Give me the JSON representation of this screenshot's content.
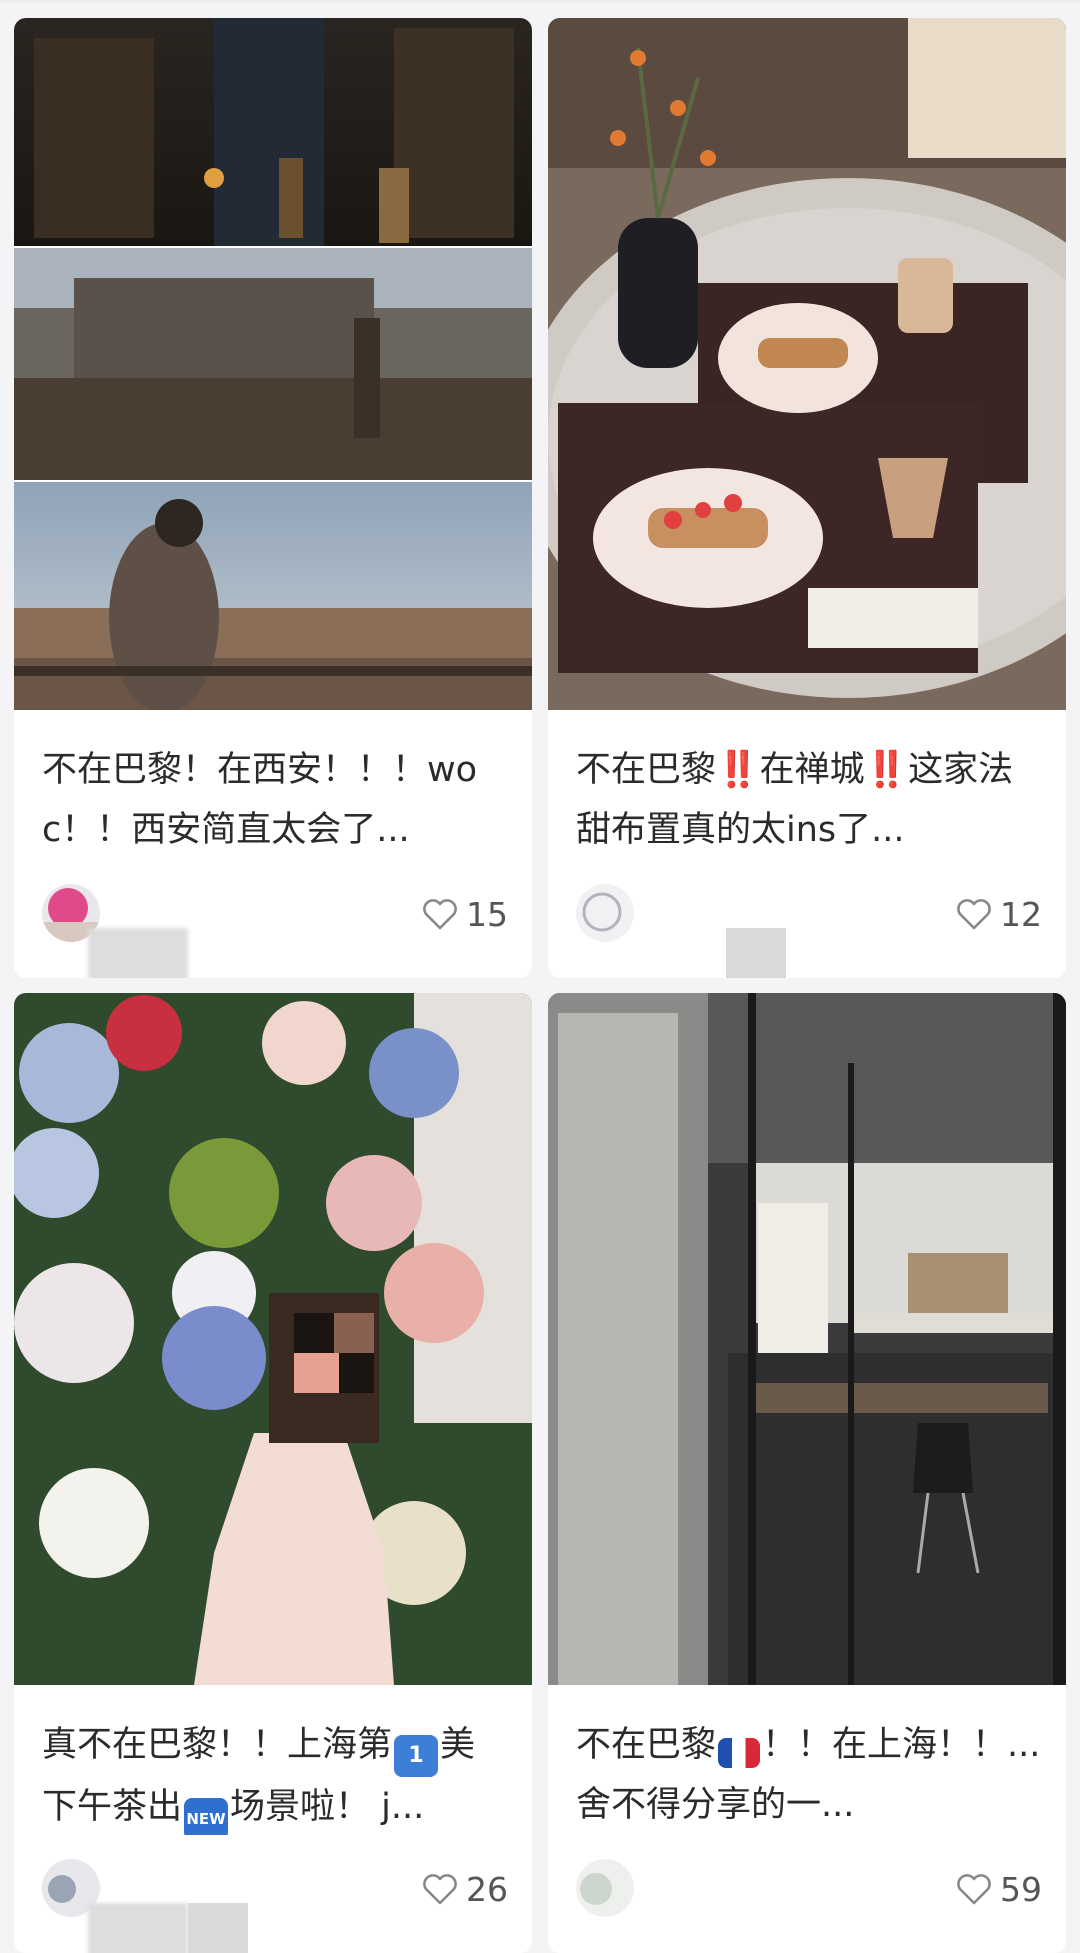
{
  "posts": [
    {
      "title": "不在巴黎！在西安！！！woc！！西安简直太会了...",
      "likes": "15",
      "image": "medieval-city-game-scenes"
    },
    {
      "title": "不在巴黎‼️在禅城‼️这家法甜布置真的太ins了...",
      "likes": "12",
      "image": "cafe-dessert-trays"
    },
    {
      "title_parts": [
        "真不在巴黎！！上海第",
        "1",
        "美下午茶出",
        "NEW",
        "场景啦！ j..."
      ],
      "likes": "26",
      "image": "flower-wall-portrait"
    },
    {
      "title_parts": [
        "不在巴黎",
        "🇫🇷",
        "！！在上海！！... 舍不得分享的一..."
      ],
      "likes": "59",
      "image": "restaurant-entrance"
    }
  ],
  "colors": {
    "heart": "#888888",
    "background": "#f4f4f6",
    "card": "#ffffff"
  },
  "icons": {
    "like": "heart-icon"
  }
}
